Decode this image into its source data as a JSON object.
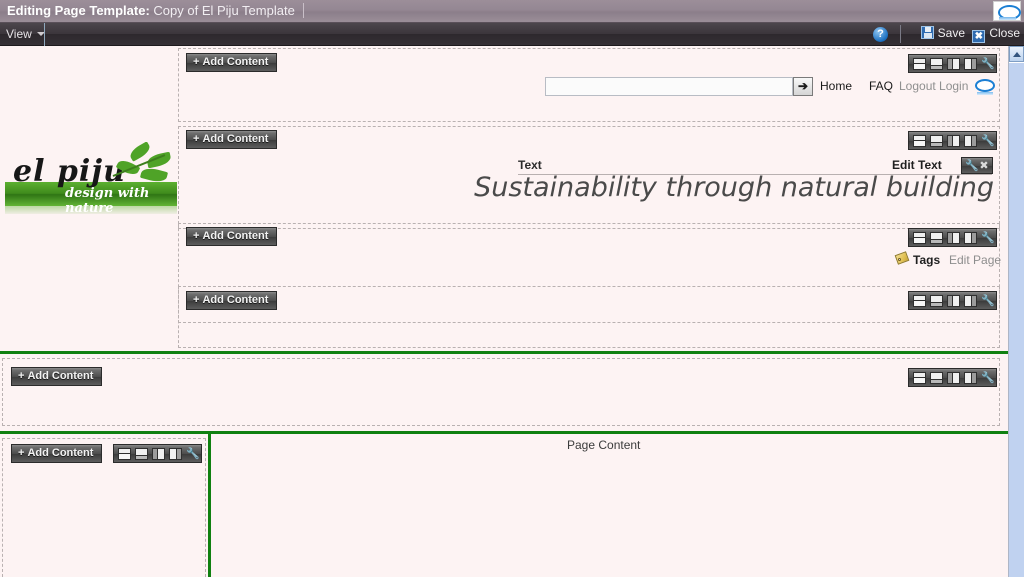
{
  "window": {
    "title_prefix": "Editing Page Template:",
    "title_value": "Copy of El Piju Template",
    "monitor_icon": "monitor-icon"
  },
  "menubar": {
    "view_label": "View",
    "help_icon_label": "?",
    "save_label": "Save",
    "close_label": "Close",
    "save_icon": "floppy-disk-icon",
    "close_icon": "blue-x-icon"
  },
  "common": {
    "add_content_label": "Add Content",
    "add_content_plus": "+",
    "wrench_glyph": "ƒ",
    "close_glyph": "×",
    "go_arrow": "➜"
  },
  "layout_icons": [
    "layout-top-split-icon",
    "layout-bottom-split-icon",
    "layout-left-split-icon",
    "layout-right-split-icon",
    "wrench-icon"
  ],
  "site_header": {
    "search_value": "",
    "search_placeholder": "",
    "nav": [
      {
        "label": "Home",
        "style": "dark"
      },
      {
        "label": "FAQ",
        "style": "dark"
      },
      {
        "label": "Logout Login",
        "style": "gray"
      }
    ],
    "account_icon": "account-oval-icon"
  },
  "logo": {
    "word": "el piju",
    "tagline": "design with nature"
  },
  "text_block": {
    "title": "Text",
    "edit_link": "Edit Text",
    "tagline": "Sustainability through natural building"
  },
  "tags_block": {
    "tags_label": "Tags",
    "edit_page_label": "Edit Page",
    "tag_icon": "tag-icon"
  },
  "page_content": {
    "label": "Page Content"
  },
  "colors": {
    "canvas_bg": "#fdf3f3",
    "divider_green": "#108010",
    "dashed_border": "#b9b1b1",
    "titlebar": "#948793",
    "menubar": "#3b353b",
    "accent_blue": "#1b7fd4"
  },
  "scrollbar": {
    "up_arrow": "scroll-up-arrow-icon"
  }
}
